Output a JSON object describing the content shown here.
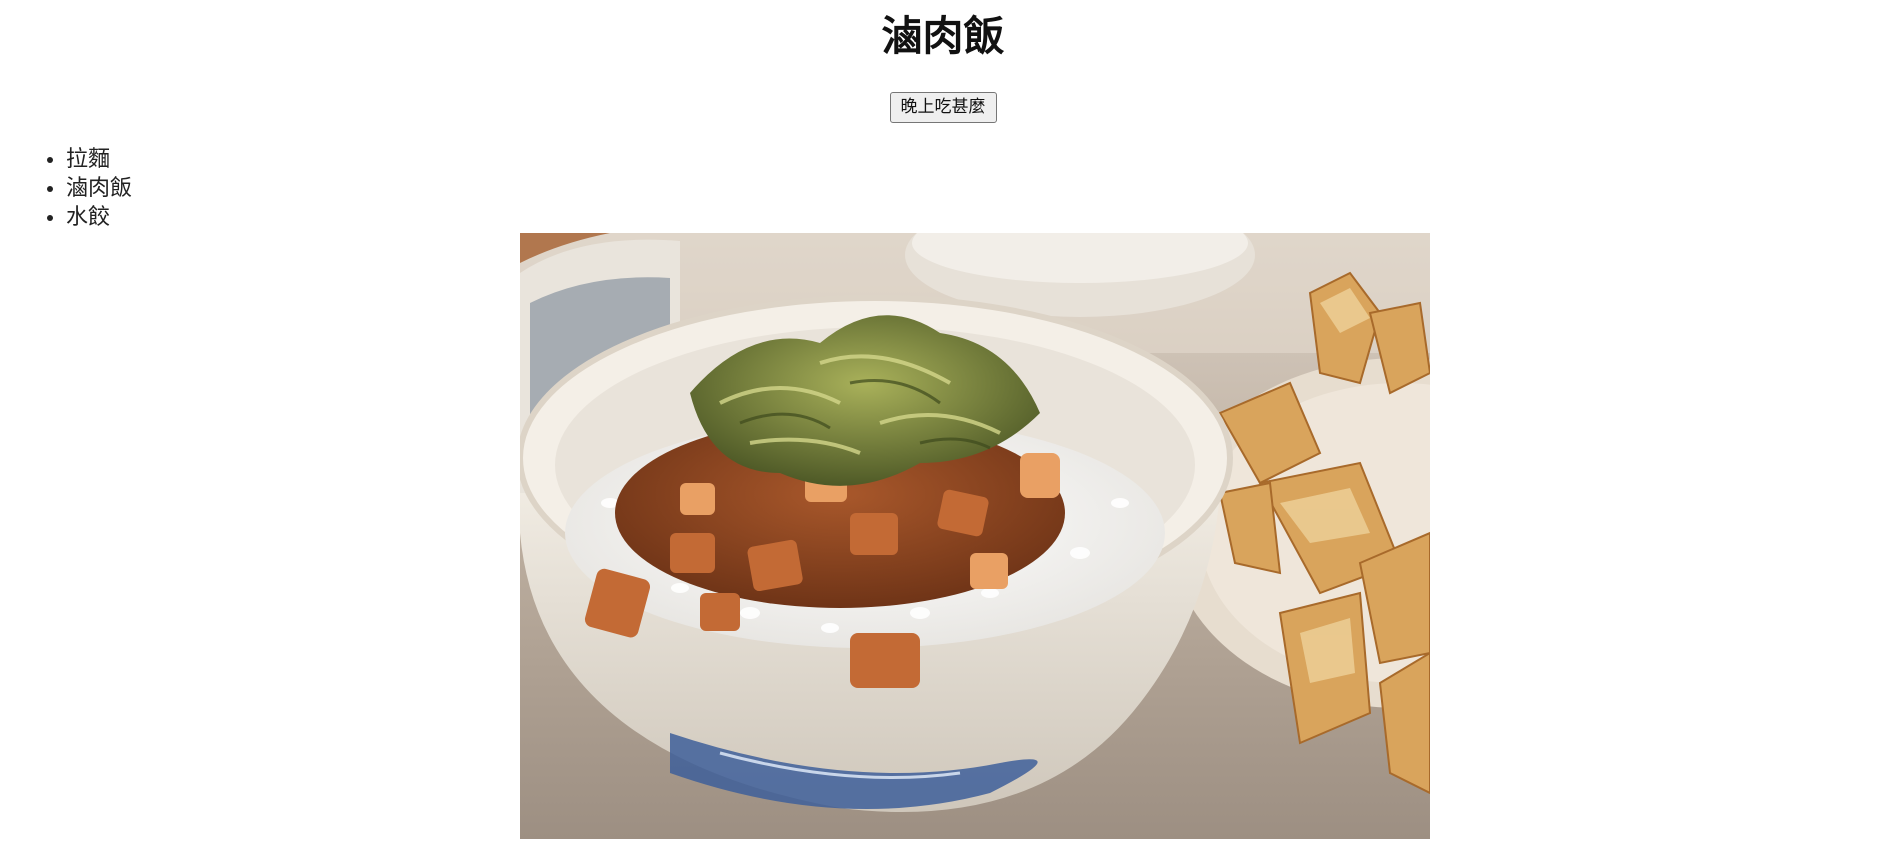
{
  "page": {
    "title": "滷肉飯"
  },
  "actions": {
    "dinner_button_label": "晚上吃甚麼"
  },
  "menu": {
    "items": [
      {
        "label": "拉麵"
      },
      {
        "label": "滷肉飯"
      },
      {
        "label": "水餃"
      }
    ]
  },
  "photo": {
    "subject": "braised pork rice bowl"
  }
}
